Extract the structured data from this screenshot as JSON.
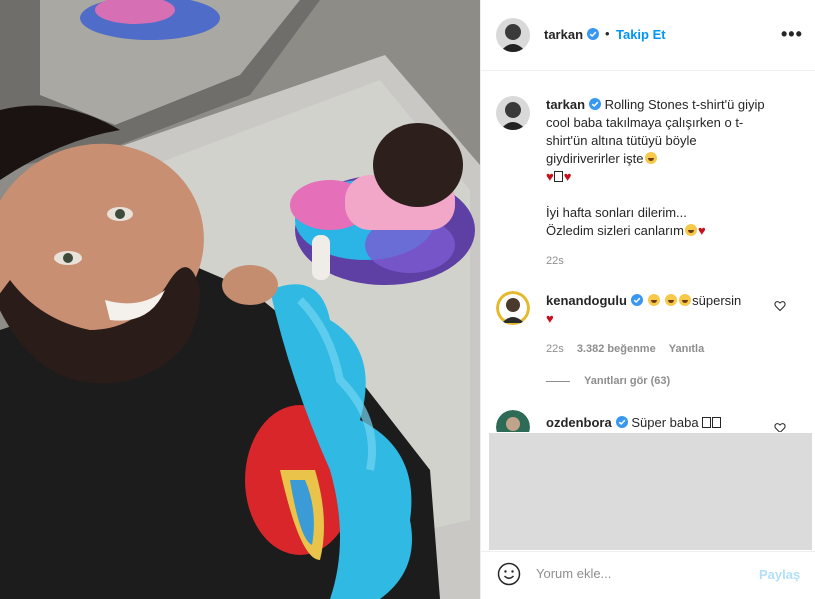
{
  "header": {
    "username": "tarkan",
    "separator": "•",
    "follow_label": "Takip Et",
    "more_label": "•••"
  },
  "caption": {
    "username": "tarkan",
    "lines": [
      "Rolling Stones t-shirt'ü giyip",
      "cool baba takılmaya çalışırken o t-",
      "shirt'ün altına tütüyü böyle",
      "giydiriverirler işte"
    ],
    "line_6": "İyi hafta sonları dilerim...",
    "line_7": "Özledim sizleri canlarım",
    "time": "22s"
  },
  "comments": [
    {
      "username": "kenandogulu",
      "text": "süpersin",
      "time": "22s",
      "likes": "3.382 beğenme",
      "reply_label": "Yanıtla",
      "view_replies": "Yanıtları gör (63)"
    },
    {
      "username": "ozdenbora",
      "text": "Süper baba"
    }
  ],
  "composer": {
    "placeholder": "Yorum ekle...",
    "post_label": "Paylaş"
  },
  "colors": {
    "accent": "#0095f6",
    "verified": "#3897f0",
    "heart": "#c7101e",
    "post_disabled": "#b2dffc"
  },
  "icons": [
    "verified-badge-icon",
    "more-options-icon",
    "like-heart-icon",
    "emoji-smile-icon"
  ]
}
